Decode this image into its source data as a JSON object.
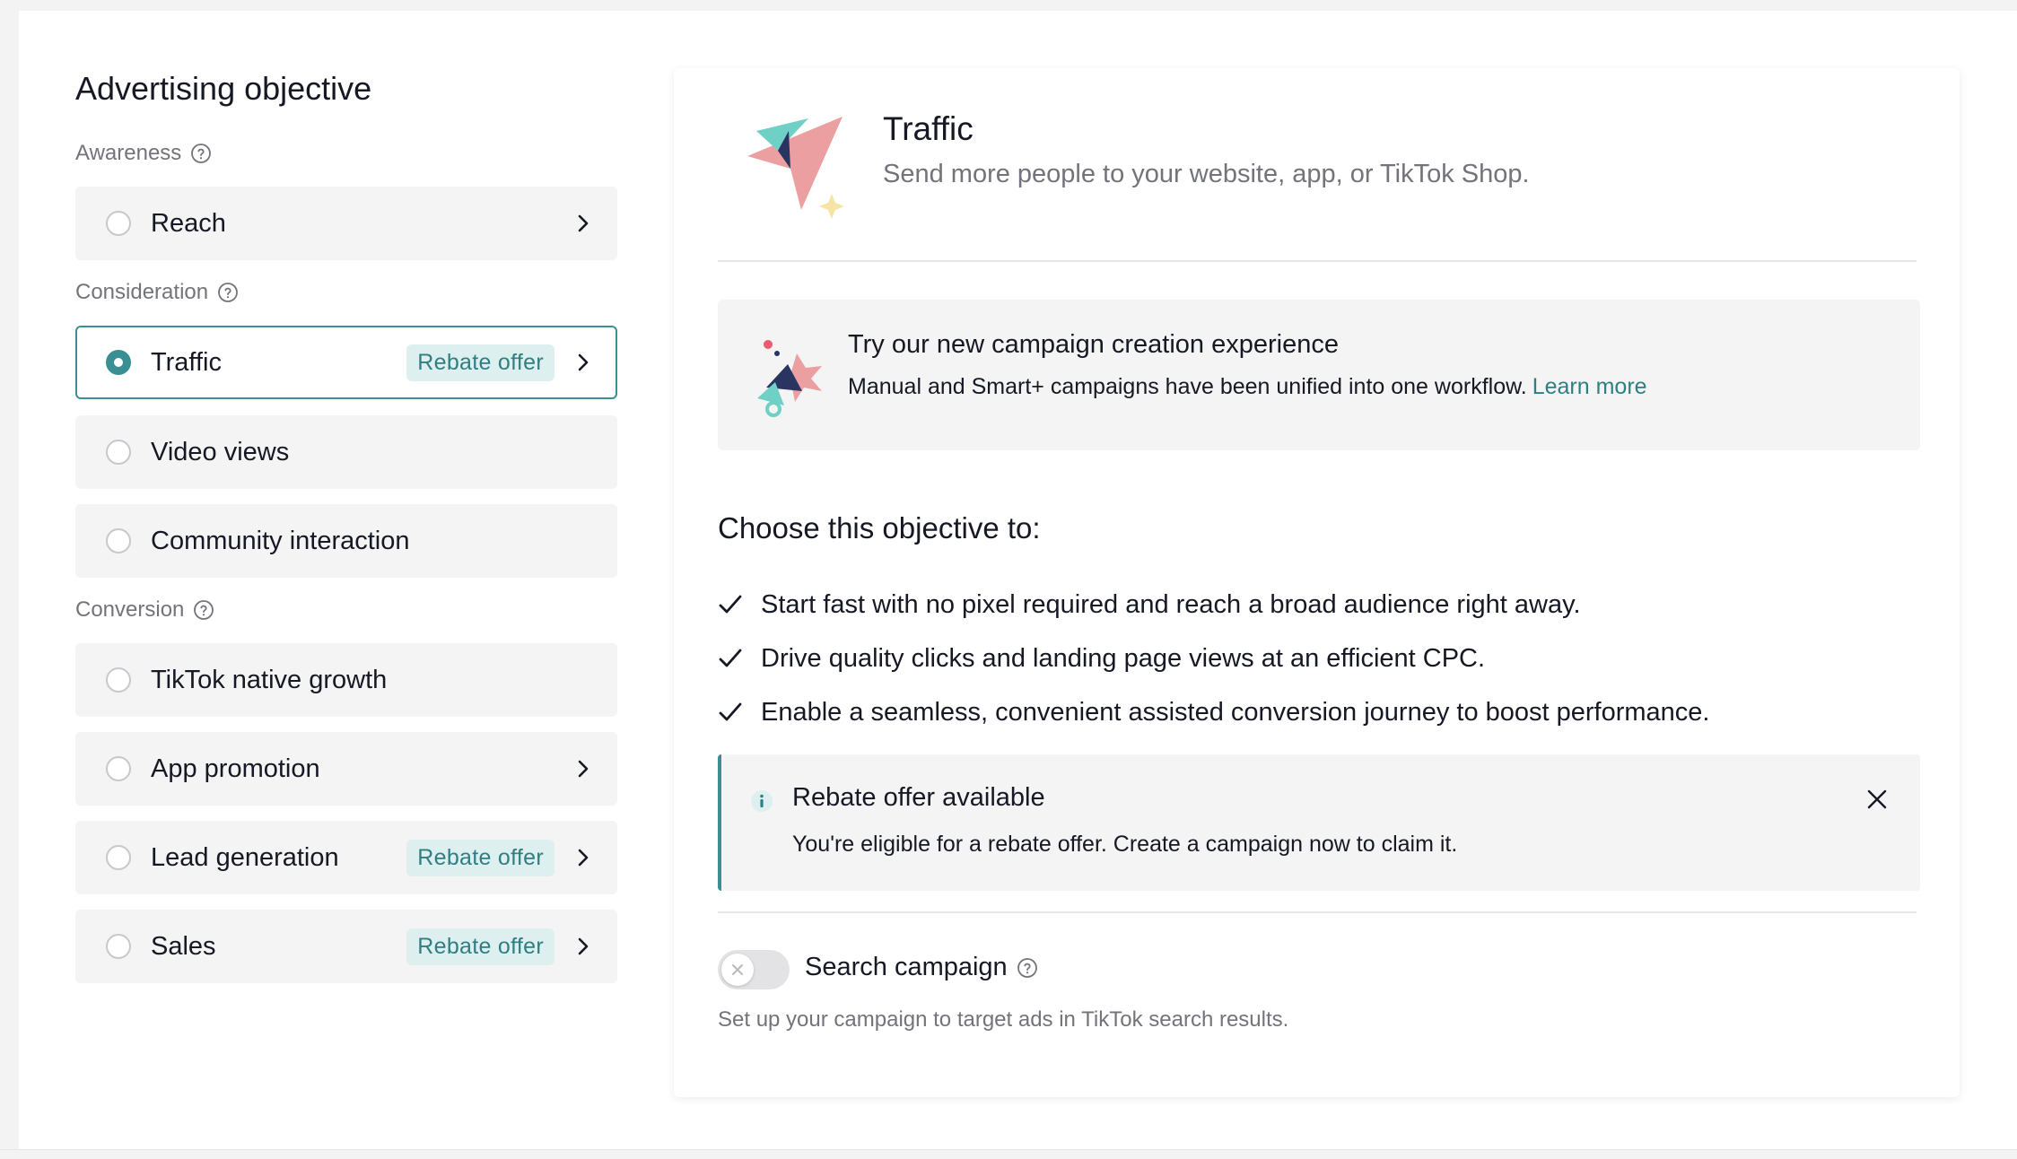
{
  "left": {
    "title": "Advertising objective",
    "groups": [
      {
        "label": "Awareness"
      },
      {
        "label": "Consideration"
      },
      {
        "label": "Conversion"
      }
    ],
    "items": [
      {
        "label": "Reach",
        "selected": false,
        "badge": ""
      },
      {
        "label": "Traffic",
        "selected": true,
        "badge": "Rebate offer"
      },
      {
        "label": "Video views",
        "selected": false,
        "badge": ""
      },
      {
        "label": "Community interaction",
        "selected": false,
        "badge": ""
      },
      {
        "label": "TikTok native growth",
        "selected": false,
        "badge": ""
      },
      {
        "label": "App promotion",
        "selected": false,
        "badge": ""
      },
      {
        "label": "Lead generation",
        "selected": false,
        "badge": "Rebate offer"
      },
      {
        "label": "Sales",
        "selected": false,
        "badge": "Rebate offer"
      }
    ]
  },
  "detail": {
    "title": "Traffic",
    "subtitle": "Send more people to your website, app, or TikTok Shop.",
    "promo": {
      "title": "Try our new campaign creation experience",
      "description": "Manual and Smart+ campaigns have been unified into one workflow.",
      "link": "Learn more"
    },
    "choose_heading": "Choose this objective to:",
    "benefits": [
      "Start fast with no pixel required and reach a broad audience right away.",
      "Drive quality clicks and landing page views at an efficient CPC.",
      "Enable a seamless, convenient assisted conversion journey to boost performance."
    ],
    "rebate_notice": {
      "title": "Rebate offer available",
      "description": "You're eligible for a rebate offer. Create a campaign now to claim it."
    },
    "search_campaign": {
      "label": "Search campaign",
      "enabled": false,
      "description": "Set up your campaign to target ads in TikTok search results."
    }
  },
  "colors": {
    "accent": "#3a8f92",
    "badge_bg": "#ddf0ef",
    "badge_text": "#2f7f82",
    "item_bg": "#f4f4f5",
    "muted_text": "#73747b"
  },
  "icons": {
    "help": "question-circle-icon",
    "chevron": "chevron-right-icon",
    "check": "check-icon",
    "info": "info-icon",
    "close": "close-icon"
  }
}
